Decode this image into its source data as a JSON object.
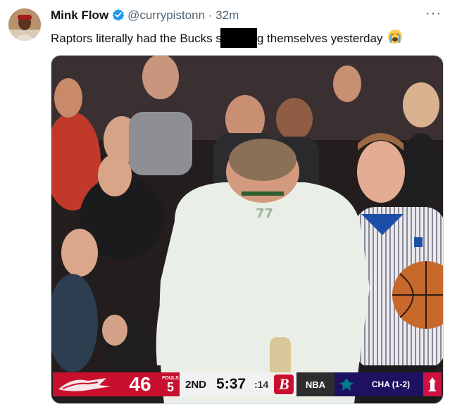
{
  "tweet": {
    "display_name": "Mink Flow",
    "handle": "@currypistonn",
    "separator": "·",
    "time": "32m",
    "more_label": "···",
    "text_before": "Raptors literally had the Bucks s",
    "text_after": "g themselves yesterday",
    "emoji": "loudly-crying-face-emoji"
  },
  "scoreboard": {
    "team_score": "46",
    "fouls_label": "FOULS",
    "fouls_value": "5",
    "period": "2ND",
    "clock": "5:37",
    "shot_clock": ":14",
    "network_logo": "B",
    "league": "NBA",
    "other_team": "CHA (1-2)"
  },
  "colors": {
    "verified_blue": "#1d9bf0",
    "raptors_red": "#c8102e",
    "hornets_purple": "#1d1160",
    "handle_gray": "#536471"
  }
}
